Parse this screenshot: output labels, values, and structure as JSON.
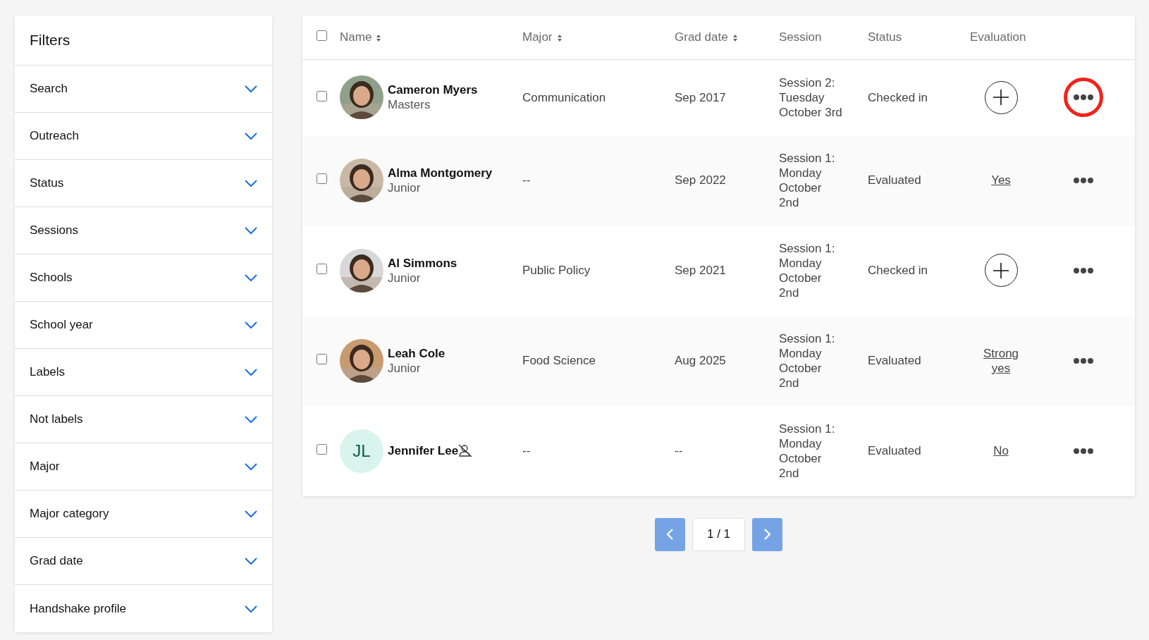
{
  "filters": {
    "title": "Filters",
    "items": [
      {
        "label": "Search",
        "expanded": false
      },
      {
        "label": "Outreach",
        "expanded": false
      },
      {
        "label": "Status",
        "expanded": false
      },
      {
        "label": "Sessions",
        "expanded": false
      },
      {
        "label": "Schools",
        "expanded": false
      },
      {
        "label": "School year",
        "expanded": false
      },
      {
        "label": "Labels",
        "expanded": false
      },
      {
        "label": "Not labels",
        "expanded": false
      },
      {
        "label": "Major",
        "expanded": false
      },
      {
        "label": "Major category",
        "expanded": false
      },
      {
        "label": "Grad date",
        "expanded": false
      },
      {
        "label": "Handshake profile",
        "expanded": false
      }
    ]
  },
  "table": {
    "select_all": {
      "checked": false
    },
    "columns": [
      {
        "label": "Name",
        "sortable": true
      },
      {
        "label": "Major",
        "sortable": true
      },
      {
        "label": "Grad date",
        "sortable": true
      },
      {
        "label": "Session",
        "sortable": false
      },
      {
        "label": "Status",
        "sortable": false
      },
      {
        "label": "Evaluation",
        "sortable": false
      }
    ],
    "rows": [
      {
        "checked": false,
        "avatar": {
          "kind": "picture"
        },
        "name": "Cameron Myers",
        "year": "Masters",
        "no_profile": false,
        "major": "Communication",
        "grad_date": "Sep 2017",
        "session_lines": [
          "Session 2:",
          "Tuesday",
          "October 3rd"
        ],
        "status": "Checked in",
        "evaluation": {
          "kind": "add"
        },
        "actions_highlighted": true
      },
      {
        "checked": false,
        "avatar": {
          "kind": "picture"
        },
        "name": "Alma Montgomery",
        "year": "Junior",
        "no_profile": false,
        "major": "--",
        "grad_date": "Sep 2022",
        "session_lines": [
          "Session 1:",
          "Monday",
          "October",
          "2nd"
        ],
        "status": "Evaluated",
        "evaluation": {
          "kind": "link",
          "text": "Yes"
        },
        "actions_highlighted": false
      },
      {
        "checked": false,
        "avatar": {
          "kind": "picture"
        },
        "name": "Al Simmons",
        "year": "Junior",
        "no_profile": false,
        "major": "Public Policy",
        "grad_date": "Sep 2021",
        "session_lines": [
          "Session 1:",
          "Monday",
          "October",
          "2nd"
        ],
        "status": "Checked in",
        "evaluation": {
          "kind": "add"
        },
        "actions_highlighted": false
      },
      {
        "checked": false,
        "avatar": {
          "kind": "picture"
        },
        "name": "Leah Cole",
        "year": "Junior",
        "no_profile": false,
        "major": "Food Science",
        "grad_date": "Aug 2025",
        "session_lines": [
          "Session 1:",
          "Monday",
          "October",
          "2nd"
        ],
        "status": "Evaluated",
        "evaluation": {
          "kind": "link",
          "text": "Strong yes"
        },
        "actions_highlighted": false
      },
      {
        "checked": false,
        "avatar": {
          "kind": "initials",
          "text": "JL"
        },
        "name": "Jennifer Lee",
        "no_profile": true,
        "major": "--",
        "grad_date": "--",
        "session_lines": [
          "Session 1:",
          "Monday",
          "October",
          "2nd"
        ],
        "status": "Evaluated",
        "evaluation": {
          "kind": "link",
          "text": "No"
        },
        "actions_highlighted": false
      }
    ]
  },
  "pagination": {
    "page": "1 / 1"
  }
}
